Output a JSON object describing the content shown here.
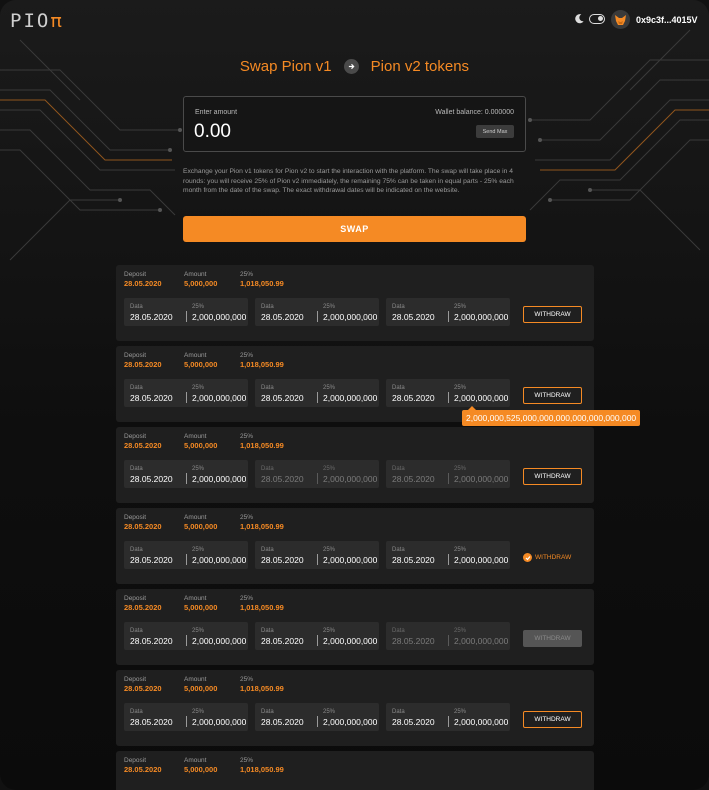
{
  "header": {
    "logo": "PIO",
    "logo_accent": "π",
    "theme_icon": "moon-icon",
    "wallet_icon": "metamask-fox-icon",
    "wallet_address": "0x9c3f...4015V"
  },
  "title": {
    "from": "Swap Pion v1",
    "arrow_icon": "arrow-right-icon",
    "to": "Pion v2 tokens"
  },
  "amount": {
    "label": "Enter amount",
    "value": "0.00",
    "wallet_balance": "Wallet balance: 0.000000",
    "send_max": "Send Max"
  },
  "description": "Exchange your Pion v1 tokens for Pion v2 to start the interaction with the platform. The swap will take place in 4 rounds: you will receive 25% of Pion v2 immediately, the remaining 75% can be taken in equal parts - 25% each month from the date of the swap. The exact withdrawal dates will be indicated on the website.",
  "swap_button": "SWAP",
  "colors": {
    "accent": "#f58a24",
    "card": "#1f1f1f",
    "segment": "#2c2c2c"
  },
  "tooltip": "2,000,000,525,000,000,000,000,000,000,000",
  "deposits": [
    {
      "deposit_label": "Deposit",
      "deposit": "28.05.2020",
      "amount_label": "Amount",
      "amount": "5,000,000",
      "pct_label": "25%",
      "pct_value": "1,018,050.99",
      "segments": [
        {
          "date_label": "Data",
          "date": "28.05.2020",
          "pct_label": "25%",
          "value": "2,000,000,000",
          "dim": false
        },
        {
          "date_label": "Data",
          "date": "28.05.2020",
          "pct_label": "25%",
          "value": "2,000,000,000",
          "dim": false
        },
        {
          "date_label": "Data",
          "date": "28.05.2020",
          "pct_label": "25%",
          "value": "2,000,000,000",
          "dim": false
        }
      ],
      "withdraw": {
        "label": "WITHDRAW",
        "state": "active"
      }
    },
    {
      "deposit_label": "Deposit",
      "deposit": "28.05.2020",
      "amount_label": "Amount",
      "amount": "5,000,000",
      "pct_label": "25%",
      "pct_value": "1,018,050.99",
      "segments": [
        {
          "date_label": "Data",
          "date": "28.05.2020",
          "pct_label": "25%",
          "value": "2,000,000,000",
          "dim": false
        },
        {
          "date_label": "Data",
          "date": "28.05.2020",
          "pct_label": "25%",
          "value": "2,000,000,000",
          "dim": false
        },
        {
          "date_label": "Data",
          "date": "28.05.2020",
          "pct_label": "25%",
          "value": "2,000,000,000",
          "dim": false
        }
      ],
      "withdraw": {
        "label": "WITHDRAW",
        "state": "active"
      }
    },
    {
      "deposit_label": "Deposit",
      "deposit": "28.05.2020",
      "amount_label": "Amount",
      "amount": "5,000,000",
      "pct_label": "25%",
      "pct_value": "1,018,050.99",
      "segments": [
        {
          "date_label": "Data",
          "date": "28.05.2020",
          "pct_label": "25%",
          "value": "2,000,000,000",
          "dim": false
        },
        {
          "date_label": "Data",
          "date": "28.05.2020",
          "pct_label": "25%",
          "value": "2,000,000,000",
          "dim": true
        },
        {
          "date_label": "Data",
          "date": "28.05.2020",
          "pct_label": "25%",
          "value": "2,000,000,000",
          "dim": true
        }
      ],
      "withdraw": {
        "label": "WITHDRAW",
        "state": "active"
      }
    },
    {
      "deposit_label": "Deposit",
      "deposit": "28.05.2020",
      "amount_label": "Amount",
      "amount": "5,000,000",
      "pct_label": "25%",
      "pct_value": "1,018,050.99",
      "segments": [
        {
          "date_label": "Data",
          "date": "28.05.2020",
          "pct_label": "25%",
          "value": "2,000,000,000",
          "dim": false
        },
        {
          "date_label": "Data",
          "date": "28.05.2020",
          "pct_label": "25%",
          "value": "2,000,000,000",
          "dim": false
        },
        {
          "date_label": "Data",
          "date": "28.05.2020",
          "pct_label": "25%",
          "value": "2,000,000,000",
          "dim": false
        }
      ],
      "withdraw": {
        "label": "WITHDRAW",
        "state": "done"
      }
    },
    {
      "deposit_label": "Deposit",
      "deposit": "28.05.2020",
      "amount_label": "Amount",
      "amount": "5,000,000",
      "pct_label": "25%",
      "pct_value": "1,018,050.99",
      "segments": [
        {
          "date_label": "Data",
          "date": "28.05.2020",
          "pct_label": "25%",
          "value": "2,000,000,000",
          "dim": false
        },
        {
          "date_label": "Data",
          "date": "28.05.2020",
          "pct_label": "25%",
          "value": "2,000,000,000",
          "dim": false
        },
        {
          "date_label": "Data",
          "date": "28.05.2020",
          "pct_label": "25%",
          "value": "2,000,000,000",
          "dim": true
        }
      ],
      "withdraw": {
        "label": "WITHDRAW",
        "state": "disabled"
      }
    },
    {
      "deposit_label": "Deposit",
      "deposit": "28.05.2020",
      "amount_label": "Amount",
      "amount": "5,000,000",
      "pct_label": "25%",
      "pct_value": "1,018,050.99",
      "segments": [
        {
          "date_label": "Data",
          "date": "28.05.2020",
          "pct_label": "25%",
          "value": "2,000,000,000",
          "dim": false
        },
        {
          "date_label": "Data",
          "date": "28.05.2020",
          "pct_label": "25%",
          "value": "2,000,000,000",
          "dim": false
        },
        {
          "date_label": "Data",
          "date": "28.05.2020",
          "pct_label": "25%",
          "value": "2,000,000,000",
          "dim": false
        }
      ],
      "withdraw": {
        "label": "WITHDRAW",
        "state": "active"
      }
    },
    {
      "deposit_label": "Deposit",
      "deposit": "28.05.2020",
      "amount_label": "Amount",
      "amount": "5,000,000",
      "pct_label": "25%",
      "pct_value": "1,018,050.99",
      "segments": [],
      "withdraw": null
    }
  ]
}
